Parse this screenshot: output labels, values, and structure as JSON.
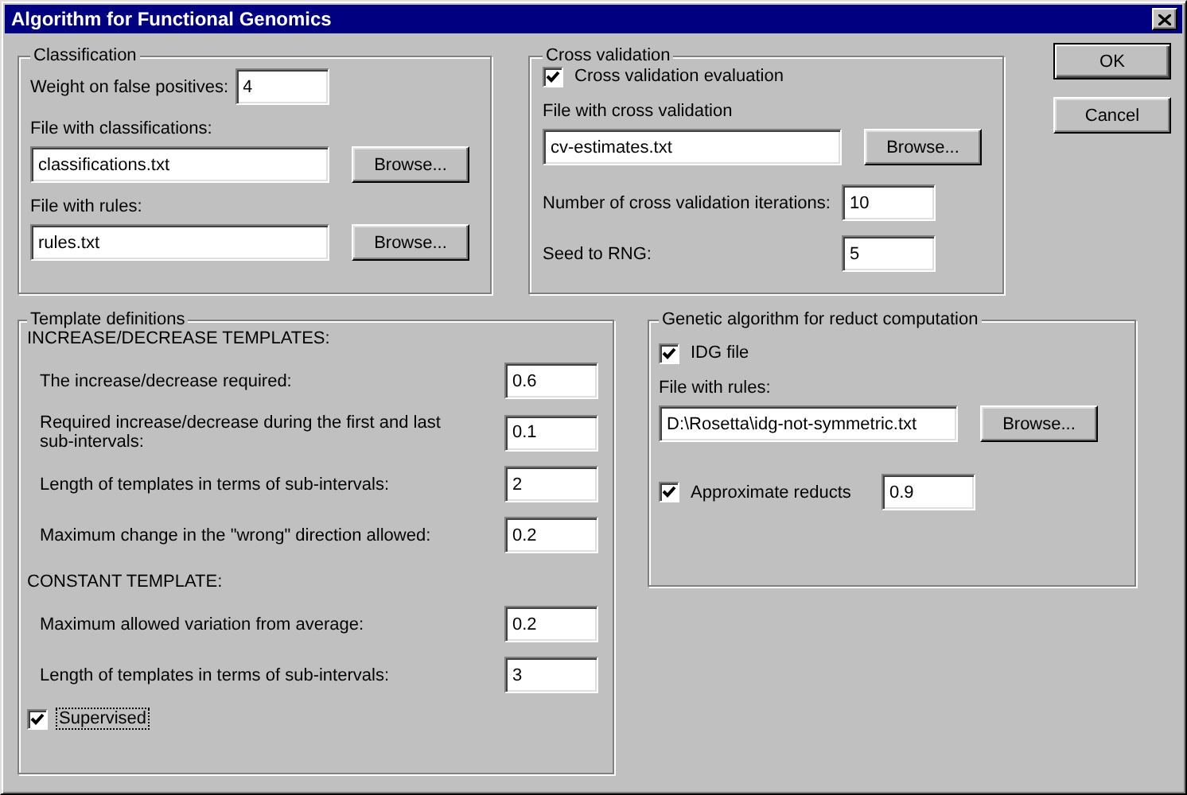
{
  "window": {
    "title": "Algorithm for Functional Genomics"
  },
  "classification": {
    "title": "Classification",
    "items": [
      {
        "kind": "inline",
        "label": "Weight on false positives:",
        "value": "4"
      },
      {
        "kind": "file",
        "label": "File with classifications:",
        "value": "classifications.txt",
        "button": "Browse..."
      },
      {
        "kind": "file",
        "label": "File with rules:",
        "value": "rules.txt",
        "button": "Browse..."
      }
    ]
  },
  "cross_validation": {
    "title": "Cross validation",
    "items": [
      {
        "kind": "checkbox",
        "label": "Cross validation evaluation",
        "checked": true,
        "focused": false
      },
      {
        "kind": "file",
        "label": "File with cross validation",
        "value": "cv-estimates.txt",
        "button": "Browse..."
      },
      {
        "kind": "aligned",
        "label": "Number of cross validation iterations:",
        "value": "10"
      },
      {
        "kind": "aligned",
        "label": "Seed to RNG:",
        "value": "5"
      }
    ]
  },
  "buttons": [
    {
      "label": "OK",
      "default": true
    },
    {
      "label": "Cancel",
      "default": false
    }
  ],
  "template_definitions": {
    "title": "Template definitions",
    "items": [
      {
        "kind": "heading",
        "text": "INCREASE/DECREASE TEMPLATES:"
      },
      {
        "kind": "aligned",
        "label": "The increase/decrease required:",
        "value": "0.6"
      },
      {
        "kind": "aligned",
        "label": "Required increase/decrease during the first and last sub-intervals:",
        "value": "0.1"
      },
      {
        "kind": "aligned",
        "label": "Length of templates in terms of sub-intervals:",
        "value": "2"
      },
      {
        "kind": "aligned",
        "label": "Maximum change in the \"wrong\" direction allowed:",
        "value": "0.2"
      },
      {
        "kind": "heading",
        "text": "CONSTANT TEMPLATE:"
      },
      {
        "kind": "aligned",
        "label": "Maximum allowed variation from average:",
        "value": "0.2"
      },
      {
        "kind": "aligned",
        "label": "Length of templates in terms of sub-intervals:",
        "value": "3"
      },
      {
        "kind": "checkbox",
        "label": "Supervised",
        "checked": true,
        "focused": true
      }
    ]
  },
  "genetic_algorithm": {
    "title": "Genetic algorithm for reduct computation",
    "items": [
      {
        "kind": "checkbox",
        "label": "IDG file",
        "checked": true,
        "focused": false
      },
      {
        "kind": "file",
        "label": "File with rules:",
        "value": "D:\\Rosetta\\idg-not-symmetric.txt",
        "button": "Browse..."
      },
      {
        "kind": "check_field",
        "label": "Approximate reducts",
        "checked": true,
        "value": "0.9"
      }
    ]
  }
}
